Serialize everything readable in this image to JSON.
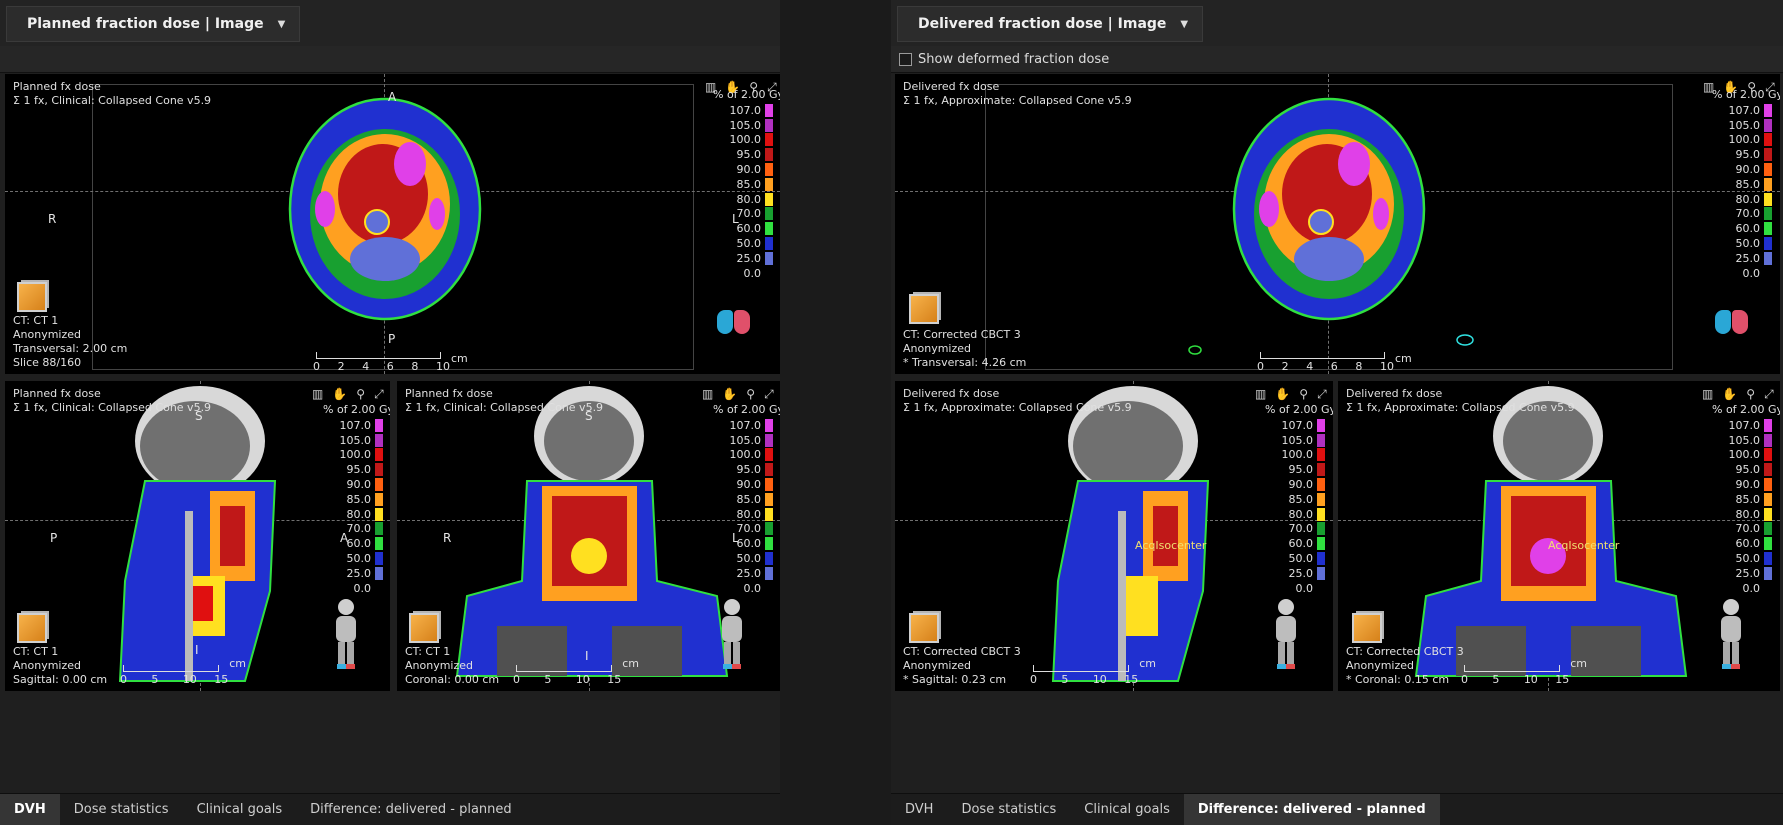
{
  "left": {
    "header_title": "Planned fraction dose | Image",
    "views": {
      "trans": {
        "name": "Planned fx dose",
        "algo": "Σ 1 fx, Clinical: Collapsed Cone v5.9",
        "bottom": [
          "CT: CT 1",
          "Anonymized",
          "Transversal: 2.00 cm",
          "Slice 88/160"
        ],
        "o1": "A",
        "o2": "P",
        "o3": "R",
        "o4": "L"
      },
      "sag": {
        "name": "Planned fx dose",
        "algo": "Σ 1 fx, Clinical: Collapsed Cone v5.9",
        "bottom": [
          "CT: CT 1",
          "Anonymized",
          "Sagittal: 0.00 cm"
        ],
        "o1": "S",
        "o2": "I",
        "o3": "P",
        "o4": "A"
      },
      "cor": {
        "name": "Planned fx dose",
        "algo": "Σ 1 fx, Clinical: Collapsed Cone v5.9",
        "bottom": [
          "CT: CT 1",
          "Anonymized",
          "Coronal: 0.00 cm"
        ],
        "o1": "S",
        "o2": "I",
        "o3": "R",
        "o4": "L"
      }
    },
    "tabs": [
      "DVH",
      "Dose statistics",
      "Clinical goals",
      "Difference: delivered - planned"
    ],
    "active_tab": 0
  },
  "right": {
    "header_title": "Delivered fraction dose | Image",
    "checkbox_label": "Show deformed fraction dose",
    "views": {
      "trans": {
        "name": "Delivered fx dose",
        "algo": "Σ 1 fx, Approximate: Collapsed Cone v5.9",
        "bottom": [
          "CT: Corrected CBCT 3",
          "Anonymized",
          "* Transversal: 4.26 cm"
        ],
        "o1": "",
        "o2": "",
        "o3": "",
        "o4": ""
      },
      "sag": {
        "name": "Delivered fx dose",
        "algo": "Σ 1 fx, Approximate: Collapsed Cone v5.9",
        "bottom": [
          "CT: Corrected CBCT 3",
          "Anonymized",
          "* Sagittal: 0.23 cm"
        ],
        "o1": "",
        "o2": "",
        "o3": "",
        "o4": "",
        "iso": "AcqIsocenter"
      },
      "cor": {
        "name": "Delivered fx dose",
        "algo": "Σ 1 fx, Approximate: Collapsed Cone v5.9",
        "bottom": [
          "CT: Corrected CBCT 3",
          "Anonymized",
          "* Coronal: 0.15 cm"
        ],
        "o1": "",
        "o2": "",
        "o3": "",
        "o4": "",
        "iso": "AcqIsocenter"
      }
    },
    "tabs": [
      "DVH",
      "Dose statistics",
      "Clinical goals",
      "Difference: delivered - planned"
    ],
    "active_tab": 3
  },
  "legend": {
    "title": "% of 2.00 Gy",
    "levels": [
      {
        "v": "107.0",
        "c": "#e040e8"
      },
      {
        "v": "105.0",
        "c": "#b030c0"
      },
      {
        "v": "100.0",
        "c": "#e01010"
      },
      {
        "v": "95.0",
        "c": "#c01818"
      },
      {
        "v": "90.0",
        "c": "#ff6010"
      },
      {
        "v": "85.0",
        "c": "#ffa020"
      },
      {
        "v": "80.0",
        "c": "#ffe020"
      },
      {
        "v": "70.0",
        "c": "#18a030"
      },
      {
        "v": "60.0",
        "c": "#30e040"
      },
      {
        "v": "50.0",
        "c": "#2030d0"
      },
      {
        "v": "25.0",
        "c": "#6070d8"
      },
      {
        "v": "0.0",
        "c": "#000000"
      }
    ]
  },
  "ruler": {
    "unit": "cm",
    "trans_ticks": [
      "0",
      "2",
      "4",
      "6",
      "8",
      "10"
    ],
    "small_ticks": [
      "0",
      "5",
      "10",
      "15"
    ]
  },
  "icons": {
    "tools": [
      "ruler-icon",
      "pan-icon",
      "zoom-icon",
      "fit-icon"
    ]
  }
}
